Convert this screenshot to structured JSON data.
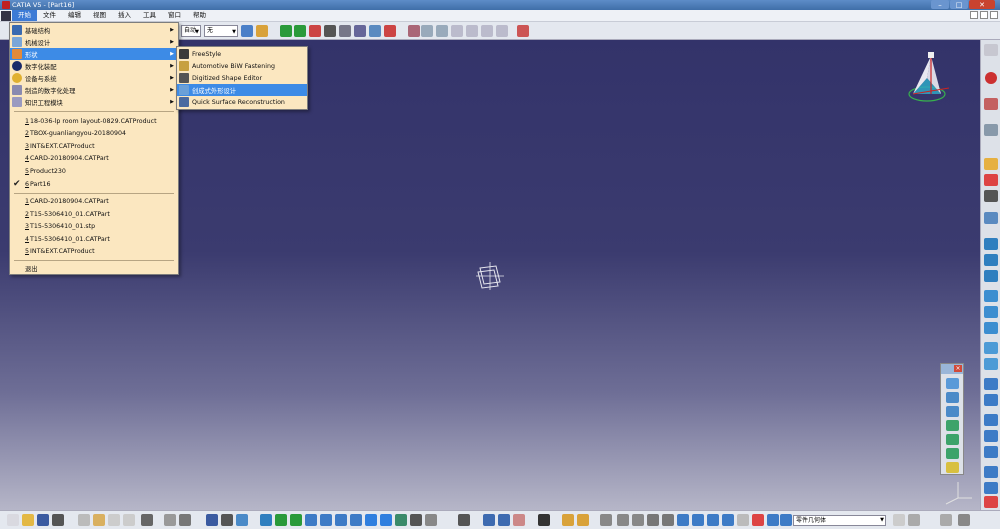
{
  "window": {
    "title": "CATIA V5 - [Part16]",
    "minimize": "–",
    "maximize": "□",
    "close": "✕"
  },
  "menubar": {
    "items": [
      "开始",
      "文件",
      "编辑",
      "视图",
      "插入",
      "工具",
      "窗口",
      "帮助"
    ]
  },
  "toolbar": {
    "combo1_value": "自动",
    "combo2_value": "无"
  },
  "start_menu": {
    "modules": [
      {
        "label": "基础结构",
        "has_sub": true
      },
      {
        "label": "机械设计",
        "has_sub": true
      },
      {
        "label": "形状",
        "has_sub": true
      },
      {
        "label": "数字化装配",
        "has_sub": true
      },
      {
        "label": "设备与系统",
        "has_sub": true
      },
      {
        "label": "制造的数字化处理",
        "has_sub": true
      },
      {
        "label": "知识工程模块",
        "has_sub": true
      }
    ],
    "recent_docs": [
      {
        "num": "1",
        "label": "18-036-lp room layout-0829.CATProduct"
      },
      {
        "num": "2",
        "label": "TBOX-guanliangyou-20180904"
      },
      {
        "num": "3",
        "label": "INT&EXT.CATProduct"
      },
      {
        "num": "4",
        "label": "CARD-20180904.CATPart"
      },
      {
        "num": "5",
        "label": "Product230"
      },
      {
        "num": "6",
        "label": "Part16"
      }
    ],
    "recent_files": [
      {
        "num": "1",
        "label": "CARD-20180904.CATPart"
      },
      {
        "num": "2",
        "label": "T15-5306410_01.CATPart"
      },
      {
        "num": "3",
        "label": "T15-5306410_01.stp"
      },
      {
        "num": "4",
        "label": "T15-5306410_01.CATPart"
      },
      {
        "num": "5",
        "label": "INT&EXT.CATProduct"
      }
    ],
    "exit": "退出"
  },
  "submenu": {
    "items": [
      "FreeStyle",
      "Automotive BiW Fastening",
      "Digitized Shape Editor",
      "创成式外形设计",
      "Quick Surface Reconstruction"
    ]
  },
  "status": {
    "part_body": "零件几何体"
  },
  "colors": {
    "menu_bg": "#fbe7c0",
    "highlight": "#3d8be6",
    "viewport_top": "#33336a",
    "viewport_bottom": "#b6b6c8"
  }
}
